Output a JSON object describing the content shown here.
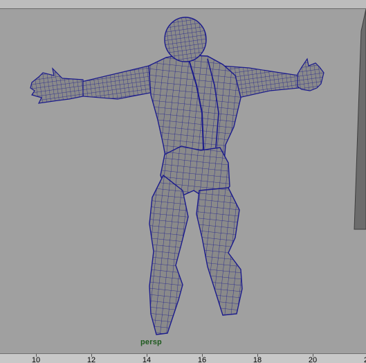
{
  "viewport": {
    "camera": "persp",
    "wireframe_color": "#1a1a8c",
    "shaded_color": "#8a8a8a",
    "background_color": "#a0a0a0",
    "object": "humanoid-muscle-mesh"
  },
  "timeline": {
    "ticks": [
      {
        "label": "10"
      },
      {
        "label": "12"
      },
      {
        "label": "14"
      },
      {
        "label": "16"
      },
      {
        "label": "18"
      },
      {
        "label": "20"
      },
      {
        "label": "2"
      }
    ]
  }
}
